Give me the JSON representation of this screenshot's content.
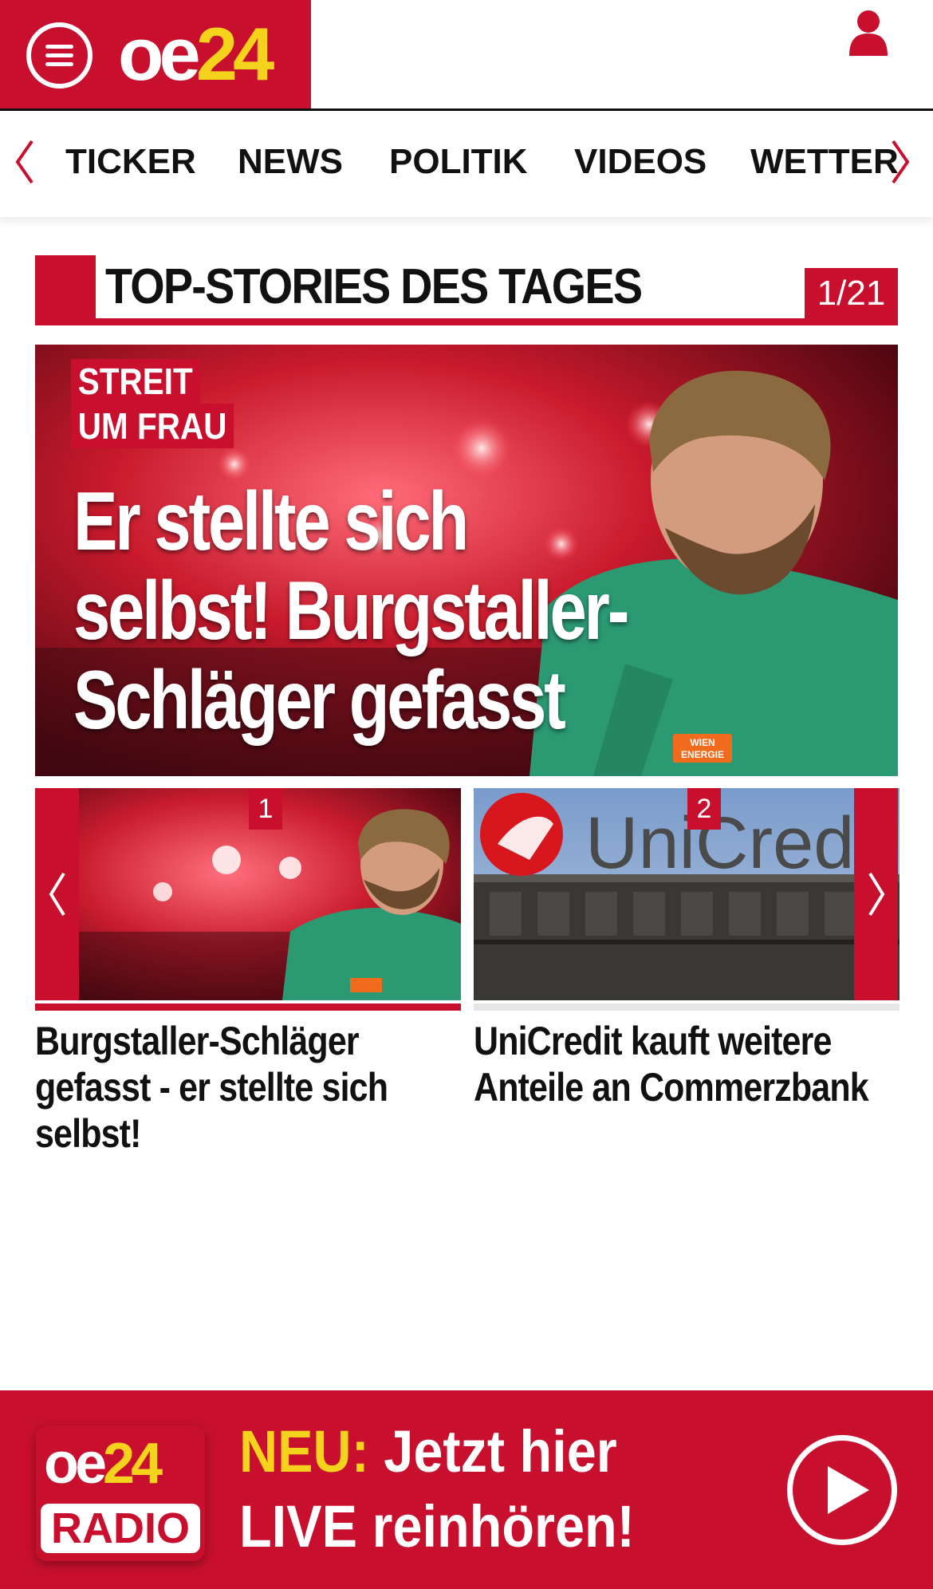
{
  "header": {
    "logo_oe": "oe",
    "logo_num": "24"
  },
  "nav": {
    "items": [
      "TICKER",
      "NEWS",
      "POLITIK",
      "VIDEOS",
      "WETTER"
    ]
  },
  "section": {
    "title": "TOP-STORIES DES TAGES",
    "counter": "1/21"
  },
  "hero": {
    "kicker_line1": "STREIT",
    "kicker_line2": "UM FRAU",
    "title_line1": "Er stellte sich",
    "title_line2": "selbst! Burgstaller-",
    "title_line3": "Schläger gefasst",
    "jersey_text_line1": "WIEN",
    "jersey_text_line2": "ENERGIE"
  },
  "cards": [
    {
      "number": "1",
      "title": "Burgstaller-Schläger gefasst - er stellte sich selbst!"
    },
    {
      "number": "2",
      "title": "UniCredit kauft weitere Anteile an Commerzbank",
      "sign_text": "UniCredi"
    }
  ],
  "radio": {
    "logo_oe": "oe",
    "logo_num": "24",
    "logo_label": "RADIO",
    "neu": "NEU:",
    "line1_rest": " Jetzt hier",
    "line2": "LIVE reinhören!"
  },
  "colors": {
    "brand_red": "#c8102e",
    "brand_yellow": "#f5d31c"
  },
  "icons": {
    "menu": "hamburger-menu-icon",
    "user": "user-icon",
    "prev": "chevron-left-icon",
    "next": "chevron-right-icon",
    "play": "play-icon"
  }
}
